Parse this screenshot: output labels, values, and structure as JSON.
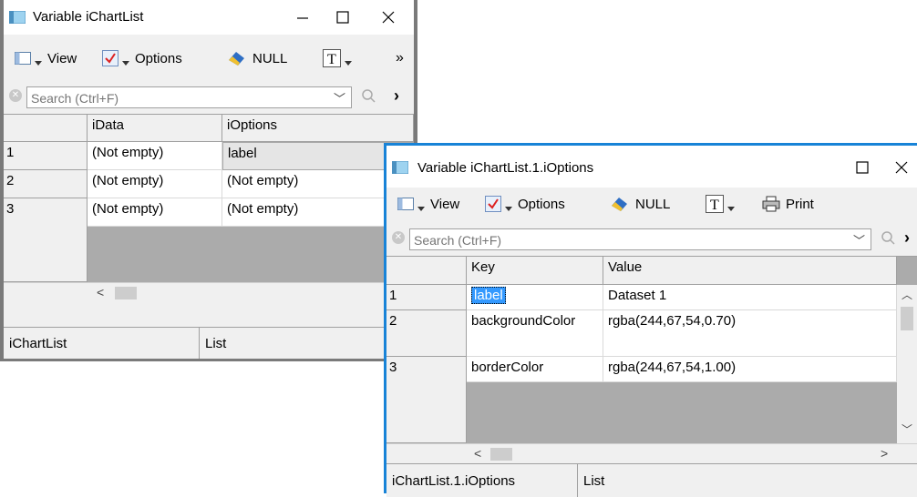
{
  "win1": {
    "title": "Variable iChartList",
    "toolbar": {
      "view": "View",
      "options": "Options",
      "null": "NULL",
      "more": "»"
    },
    "search": {
      "placeholder": "Search (Ctrl+F)"
    },
    "columns": [
      "iData",
      "iOptions"
    ],
    "rows": [
      {
        "num": "1",
        "cells": [
          "(Not empty)",
          "label"
        ]
      },
      {
        "num": "2",
        "cells": [
          "(Not empty)",
          "(Not empty)"
        ]
      },
      {
        "num": "3",
        "cells": [
          "(Not empty)",
          "(Not empty)"
        ]
      }
    ],
    "status": {
      "left": "iChartList",
      "right": "List"
    }
  },
  "win2": {
    "title": "Variable iChartList.1.iOptions",
    "toolbar": {
      "view": "View",
      "options": "Options",
      "null": "NULL",
      "print": "Print"
    },
    "search": {
      "placeholder": "Search (Ctrl+F)"
    },
    "columns": [
      "Key",
      "Value"
    ],
    "rows": [
      {
        "num": "1",
        "cells": [
          "label",
          "Dataset 1"
        ]
      },
      {
        "num": "2",
        "cells": [
          "backgroundColor",
          "rgba(244,67,54,0.70)"
        ]
      },
      {
        "num": "3",
        "cells": [
          "borderColor",
          "rgba(244,67,54,1.00)"
        ]
      }
    ],
    "status": {
      "left": "iChartList.1.iOptions",
      "right": "List"
    }
  },
  "colors": {
    "active_border": "#1883d7",
    "inactive_border": "#7a7a7a",
    "grid_empty": "#ababab",
    "selection": "#3399ff"
  }
}
